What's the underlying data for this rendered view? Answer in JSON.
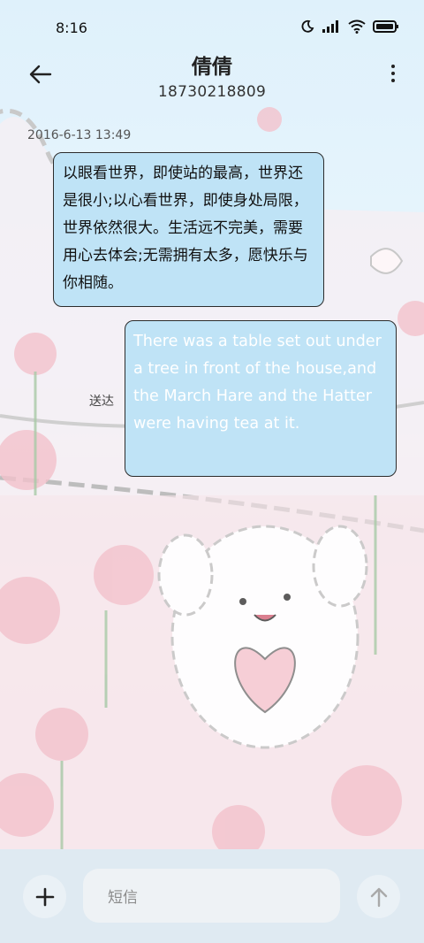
{
  "status_bar": {
    "time": "8:16"
  },
  "header": {
    "contact_name": "倩倩",
    "contact_number": "18730218809"
  },
  "conversation": {
    "timestamp": "2016-6-13 13:49",
    "incoming_message": "以眼看世界，即使站的最高，世界还是很小;以心看世界，即使身处局限，世界依然很大。生活远不完美，需要用心去体会;无需拥有太多，愿快乐与你相随。",
    "outgoing_message": "There was a table set out under a tree in front of the house,and the March Hare and the Hatter were having tea at it.",
    "outgoing_status": "送达"
  },
  "composer": {
    "placeholder": "短信"
  },
  "colors": {
    "bubble": "#bfe3f6",
    "bubble_border": "#2c2c2c",
    "bottom_bar": "#dfeaf2"
  }
}
